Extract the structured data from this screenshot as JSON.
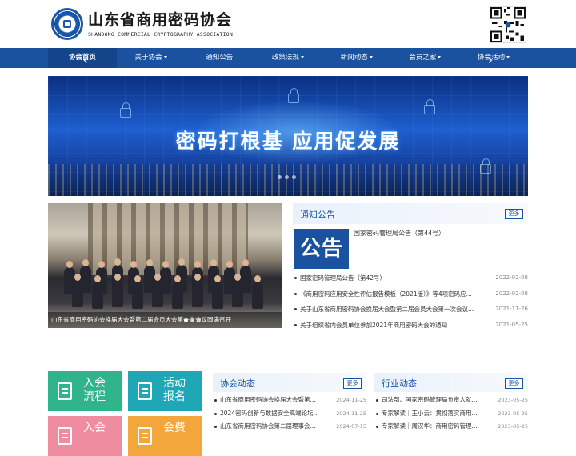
{
  "header": {
    "title": "山东省商用密码协会",
    "subtitle": "SHANDONG COMMERCIAL CRYPTOGRAPHY ASSOCIATION"
  },
  "nav": {
    "items": [
      {
        "label": "协会首页",
        "dropdown": false
      },
      {
        "label": "关于协会",
        "dropdown": true
      },
      {
        "label": "通知公告",
        "dropdown": false
      },
      {
        "label": "政策法规",
        "dropdown": true
      },
      {
        "label": "新闻动态",
        "dropdown": true
      },
      {
        "label": "会员之家",
        "dropdown": true
      },
      {
        "label": "协会活动",
        "dropdown": true
      }
    ]
  },
  "banner": {
    "text": "密码打根基  应用促发展",
    "prev_label": "‹",
    "next_label": "›"
  },
  "photo": {
    "caption": "山东省商用密码协会换届大会暨第二届会员大会第一次会议圆满召开"
  },
  "notice": {
    "title": "通知公告",
    "more": "更多",
    "image_text": "公告",
    "featured": "国家密码管理局公告（第44号）",
    "items": [
      {
        "title": "国家密码管理局公告（第42号）",
        "date": "2022-02-08"
      },
      {
        "title": "《商用密码应用安全性评估报告模板（2021版）》等4项密码应...",
        "date": "2022-02-08"
      },
      {
        "title": "关于山东省商用密码协会换届大会暨第二届会员大会第一次会议...",
        "date": "2021-11-26"
      },
      {
        "title": "关于组织省内会员单位参加2021年商用密码大会的通知",
        "date": "2021-05-25"
      }
    ]
  },
  "tiles": {
    "join_process": "入会流程",
    "event_signup": "活动报名",
    "join": "入会",
    "fee": "会费"
  },
  "assoc_news": {
    "title": "协会动态",
    "more": "更多",
    "items": [
      {
        "title": "山东省商用密码协会换届大会暨第...",
        "date": "2024-11-25"
      },
      {
        "title": "2024密码创新与数据安全高端论坛...",
        "date": "2024-11-25"
      },
      {
        "title": "山东省商用密码协会第二届理事会...",
        "date": "2024-07-15"
      }
    ]
  },
  "industry_news": {
    "title": "行业动态",
    "more": "更多",
    "items": [
      {
        "title": "司法部、国家密码管理局负责人就...",
        "date": "2023-05-25"
      },
      {
        "title": "专家解读｜王小云：贯彻落实商用...",
        "date": "2023-05-25"
      },
      {
        "title": "专家解读｜周汉华：商用密码管理...",
        "date": "2023-05-25"
      }
    ]
  }
}
